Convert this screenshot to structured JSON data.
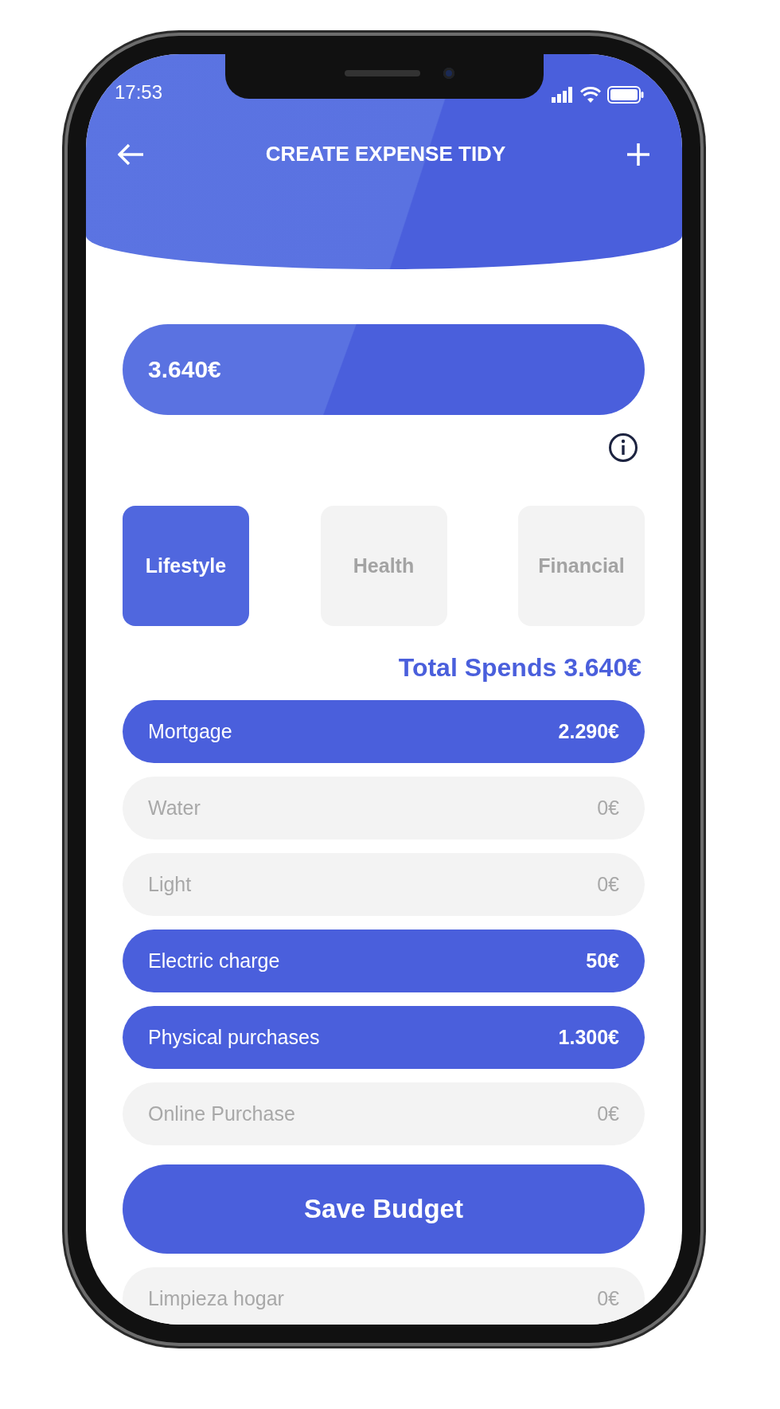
{
  "status_bar": {
    "time": "17:53"
  },
  "header": {
    "title": "CREATE EXPENSE TIDY"
  },
  "amount": {
    "value": "3.640€"
  },
  "categories": [
    {
      "label": "Lifestyle",
      "selected": true
    },
    {
      "label": "Health",
      "selected": false
    },
    {
      "label": "Financial",
      "selected": false
    }
  ],
  "total": "Total Spends 3.640€",
  "expenses": [
    {
      "name": "Mortgage",
      "amount": "2.290€",
      "filled": true
    },
    {
      "name": "Water",
      "amount": "0€",
      "filled": false
    },
    {
      "name": "Light",
      "amount": "0€",
      "filled": false
    },
    {
      "name": "Electric charge",
      "amount": "50€",
      "filled": true
    },
    {
      "name": "Physical purchases",
      "amount": "1.300€",
      "filled": true
    },
    {
      "name": "Online Purchase",
      "amount": "0€",
      "filled": false
    }
  ],
  "save_button": "Save Budget",
  "more_expenses": [
    {
      "name": "Limpieza hogar",
      "amount": "0€",
      "filled": false
    }
  ]
}
